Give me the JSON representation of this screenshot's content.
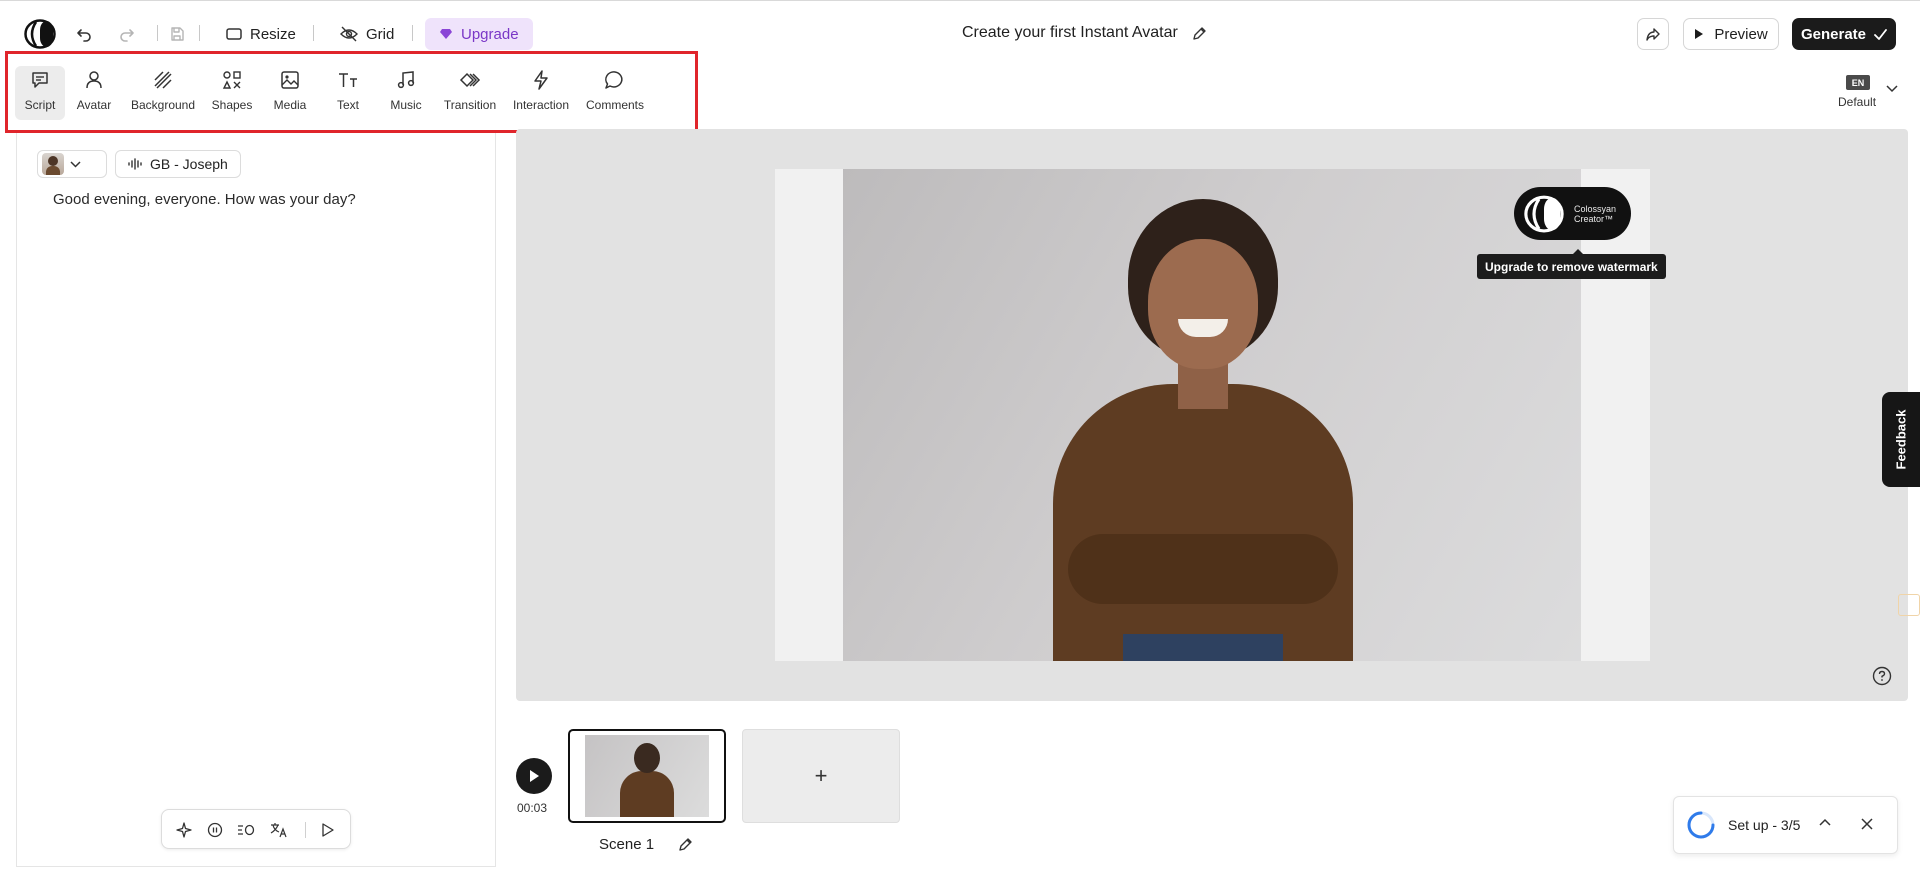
{
  "header": {
    "resize_label": "Resize",
    "grid_label": "Grid",
    "upgrade_label": "Upgrade",
    "document_title": "Create your first Instant Avatar",
    "preview_label": "Preview",
    "generate_label": "Generate"
  },
  "tools": [
    {
      "label": "Script",
      "icon": "script-icon",
      "active": true
    },
    {
      "label": "Avatar",
      "icon": "avatar-icon"
    },
    {
      "label": "Background",
      "icon": "background-icon"
    },
    {
      "label": "Shapes",
      "icon": "shapes-icon"
    },
    {
      "label": "Media",
      "icon": "media-icon"
    },
    {
      "label": "Text",
      "icon": "text-icon"
    },
    {
      "label": "Music",
      "icon": "music-icon"
    },
    {
      "label": "Transition",
      "icon": "transition-icon"
    },
    {
      "label": "Interaction",
      "icon": "interaction-icon"
    },
    {
      "label": "Comments",
      "icon": "comments-icon"
    }
  ],
  "language": {
    "code": "EN",
    "label": "Default"
  },
  "script": {
    "voice_label": "GB - Joseph",
    "text": "Good evening, everyone. How was your day?"
  },
  "canvas": {
    "watermark_line1": "Colossyan",
    "watermark_line2": "Creator™",
    "watermark_tooltip": "Upgrade to remove watermark"
  },
  "feedback_label": "Feedback",
  "timeline": {
    "time": "00:03",
    "scene_label": "Scene 1",
    "add_scene_label": "+"
  },
  "setup": {
    "label": "Set up - 3/5"
  },
  "colors": {
    "accent": "#7a37c7",
    "highlight_box": "#e0252b",
    "generate_bg": "#1b1b1b"
  }
}
